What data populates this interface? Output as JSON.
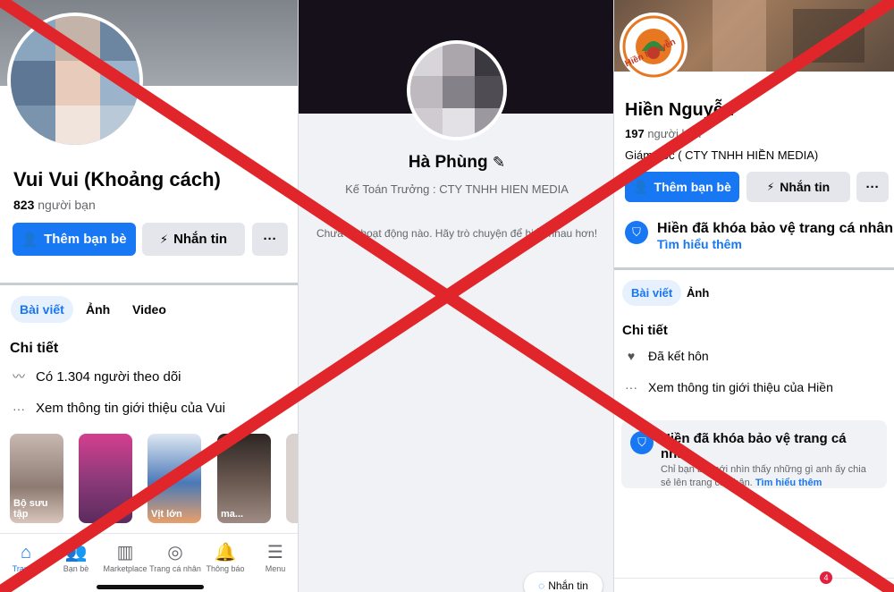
{
  "panel1": {
    "name": "Vui Vui (Khoảng cách)",
    "friends_count": "823",
    "friends_label": "người bạn",
    "add_friend_label": "Thêm bạn bè",
    "message_label": "Nhắn tin",
    "more_label": "···",
    "tabs": [
      "Bài viết",
      "Ảnh",
      "Video"
    ],
    "details_heading": "Chi tiết",
    "followers_text": "Có 1.304 người theo dõi",
    "see_intro_text": "Xem thông tin giới thiệu của Vui",
    "story_caption_1": "Bộ sưu tập",
    "story_caption_3": "Vịt lớn",
    "story_caption_4": "ma...",
    "nav": [
      "Trang...",
      "Bạn bè",
      "Marketplace",
      "Trang cá nhân",
      "Thông báo",
      "Menu"
    ]
  },
  "panel2": {
    "name": "Hà Phùng",
    "bio": "Kế Toán Trưởng : CTY TNHH HIEN MEDIA",
    "empty_state": "Chưa có hoạt động nào. Hãy trò chuyện để hiểu nhau hơn!",
    "message_label": "Nhắn tin"
  },
  "panel3": {
    "name": "Hiền Nguyễn",
    "logo_text": "Hiền Nguyễn",
    "friends_count": "197",
    "friends_label": "người bạn",
    "job": "Giám đốc ( CTY TNHH HIỀN MEDIA)",
    "add_friend_label": "Thêm bạn bè",
    "message_label": "Nhắn tin",
    "more_label": "···",
    "lock_title": "Hiền đã khóa bảo vệ trang cá nhân",
    "learn_more": "Tìm hiểu thêm",
    "tabs": [
      "Bài viết",
      "Ảnh"
    ],
    "details_heading": "Chi tiết",
    "married_text": "Đã kết hôn",
    "see_intro_text": "Xem thông tin giới thiệu của Hiền",
    "card_title": "Hiền đã khóa bảo vệ trang cá nhân",
    "card_desc": "Chỉ bạn bè mới nhìn thấy những gì anh ấy chia sẻ lên trang cá nhân.",
    "card_link": "Tìm hiểu thêm",
    "notif_badge": "4"
  },
  "colors": {
    "brand": "#1877f2",
    "cross": "#e0262a"
  }
}
